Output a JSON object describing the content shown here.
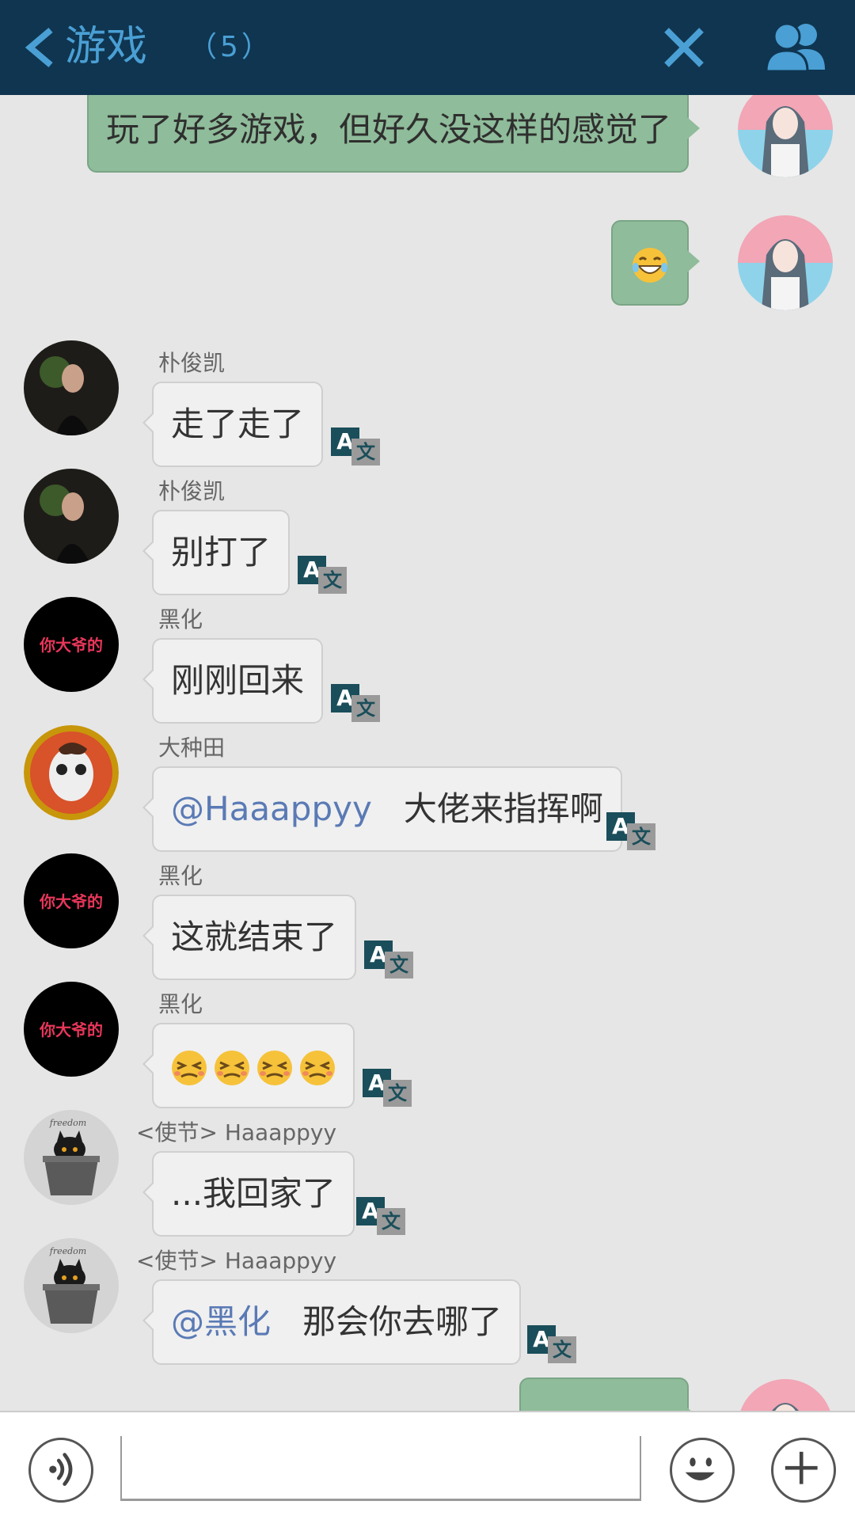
{
  "header": {
    "title": "游戏",
    "member_count": "（5）",
    "back_icon": "chevron-left-icon",
    "close_icon": "close-icon",
    "members_icon": "group-members-icon",
    "bg_color": "#0f3550",
    "accent_color": "#4a9fd4"
  },
  "messages": [
    {
      "direction": "out",
      "text": "玩了好多游戏，但好久没这样的感觉了"
    },
    {
      "direction": "out",
      "emoji": "tears-of-joy-emoji"
    },
    {
      "direction": "in",
      "sender": "朴俊凯",
      "text": "走了走了"
    },
    {
      "direction": "in",
      "sender": "朴俊凯",
      "text": "别打了"
    },
    {
      "direction": "in",
      "sender": "黑化",
      "text": "刚刚回来"
    },
    {
      "direction": "in",
      "sender": "大种田",
      "mention": "@Haaappyy",
      "text": "大佬来指挥啊"
    },
    {
      "direction": "in",
      "sender": "黑化",
      "text": "这就结束了"
    },
    {
      "direction": "in",
      "sender": "黑化",
      "emoji": "persevering-face-emoji x4"
    },
    {
      "direction": "in",
      "sender": "<使节>   Haaappyy",
      "text": "...我回家了"
    },
    {
      "direction": "in",
      "sender": "<使节>   Haaappyy",
      "mention": "@黑化",
      "text": "那会你去哪了"
    }
  ],
  "avatar_text": {
    "heihua": "你大爷的",
    "cat_caption": "freedom"
  },
  "translate_icon": {
    "latin": "A",
    "cjk": "文"
  },
  "input": {
    "placeholder": ""
  },
  "bottom_icons": [
    "voice-icon",
    "emoji-icon",
    "plus-icon"
  ],
  "colors": {
    "outgoing_bubble": "#8fbc9a",
    "incoming_bubble": "#f0f0f0",
    "mention": "#5a7ab5",
    "chat_bg": "#e6e6e6"
  }
}
